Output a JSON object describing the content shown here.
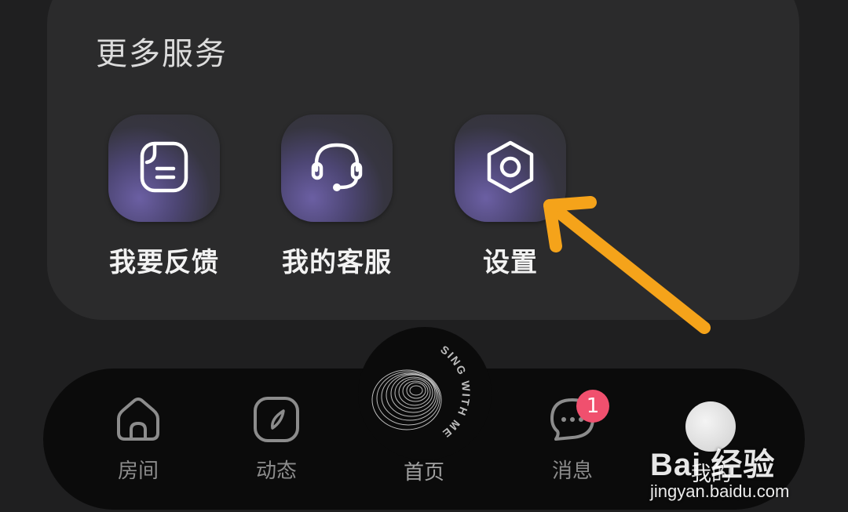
{
  "services": {
    "title": "更多服务",
    "items": [
      {
        "label": "我要反馈",
        "icon": "feedback-icon"
      },
      {
        "label": "我的客服",
        "icon": "headset-icon"
      },
      {
        "label": "设置",
        "icon": "settings-hexagon-icon"
      }
    ]
  },
  "annotation": {
    "icon": "orange-arrow-icon",
    "color": "#f5a31a"
  },
  "bottom_nav": {
    "items": [
      {
        "label": "房间",
        "icon": "house-icon"
      },
      {
        "label": "动态",
        "icon": "compass-icon"
      },
      {
        "label": "首页",
        "icon": "sing-with-me-logo",
        "logo_text": "SING WITH ME"
      },
      {
        "label": "消息",
        "icon": "chat-bubble-icon",
        "badge": "1"
      },
      {
        "label": "我的",
        "icon": "avatar-icon"
      }
    ],
    "badge_color": "#f0506e"
  },
  "watermark": {
    "main": "Bai 经验",
    "sub": "jingyan.baidu.com"
  }
}
